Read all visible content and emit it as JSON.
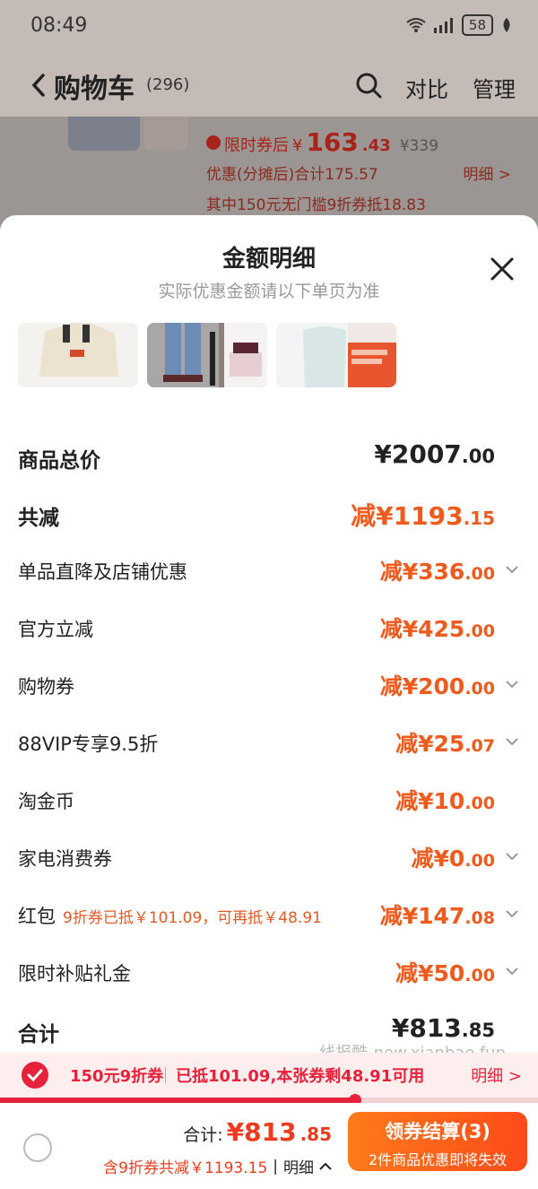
{
  "status_bar": {
    "time": "08:49",
    "battery": "58"
  },
  "header": {
    "title": "购物车",
    "count": "(296)",
    "compare": "对比",
    "manage": "管理"
  },
  "cart_item": {
    "price_label": "限时券后",
    "price_symbol": "¥",
    "price_int": "163",
    "price_dec": ".43",
    "original_price": "¥339",
    "discount_total": "优惠(分摊后)合计175.57",
    "detail_link": "明细 >",
    "coupon_line": "其中150元无门槛9折券抵18.83"
  },
  "sheet": {
    "title": "金额明细",
    "subtitle": "实际优惠金额请以下单页为准",
    "rows": [
      {
        "label": "商品总价",
        "int": "¥2007",
        "dec": ".00"
      },
      {
        "label": "共减",
        "int": "减¥1193",
        "dec": ".15"
      },
      {
        "label": "单品直降及店铺优惠",
        "int": "减¥336",
        "dec": ".00"
      },
      {
        "label": "官方立减",
        "int": "减¥425",
        "dec": ".00"
      },
      {
        "label": "购物券",
        "int": "减¥200",
        "dec": ".00"
      },
      {
        "label": "88VIP专享9.5折",
        "int": "减¥25",
        "dec": ".07"
      },
      {
        "label": "淘金币",
        "int": "减¥10",
        "dec": ".00"
      },
      {
        "label": "家电消费券",
        "int": "减¥0",
        "dec": ".00"
      },
      {
        "label": "红包",
        "note": "9折券已抵￥101.09，可再抵￥48.91",
        "int": "减¥147",
        "dec": ".08"
      },
      {
        "label": "限时补贴礼金",
        "int": "减¥50",
        "dec": ".00"
      },
      {
        "label": "合计",
        "int": "¥813",
        "dec": ".85"
      }
    ]
  },
  "watermark": "线报酷-new.xianbao.fun",
  "coupon_bar": {
    "name": "150元9折券",
    "status": "已抵101.09,本张券剩48.91可用",
    "detail": "明细 >",
    "progress": 0.66
  },
  "bottom_bar": {
    "total_label": "合计:",
    "total_int": "¥813",
    "total_dec": ".85",
    "saving_note": "含9折券共减￥1193.15",
    "detail": "明细",
    "pay_label": "领券结算(3)",
    "pay_sub": "2件商品优惠即将失效"
  },
  "colors": {
    "accent": "#ef5a1d",
    "coupon_red": "#e8213b"
  }
}
